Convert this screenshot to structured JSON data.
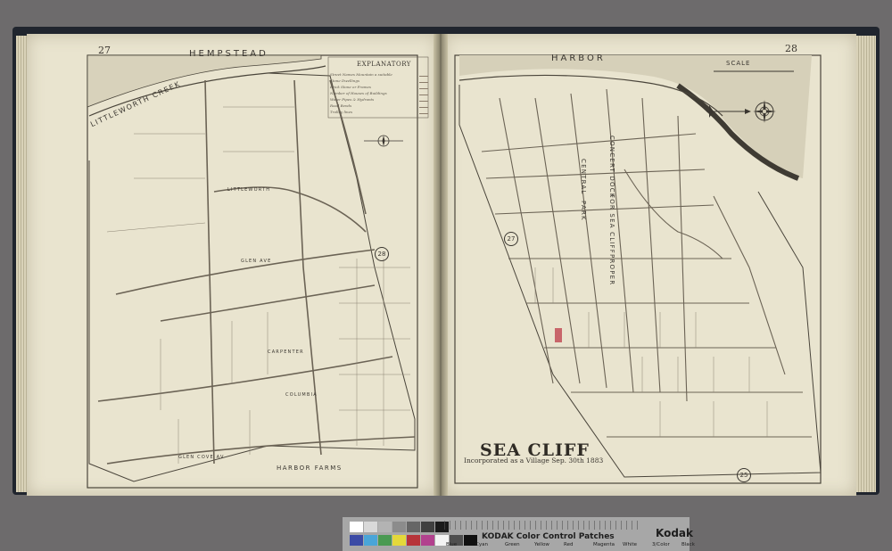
{
  "left_page": {
    "page_number": "27",
    "water_label": "HEMPSTEAD",
    "creek_label": "LITTLEWORTH CREEK",
    "legend": {
      "title": "EXPLANATORY",
      "items": [
        "Street Names Mountain a suitable",
        "Stone Dwellings",
        "Brick Stone or Frames",
        "Number of Houses of Buildings",
        "Water Pipes & Hydrants",
        "Road Bends",
        "Trolley lines"
      ]
    },
    "circled_number": "28",
    "bottom_label": "HARBOR FARMS",
    "street_labels": [
      "LITTLEWORTH",
      "GLEN AVE",
      "CARPENTER",
      "COLUMBIA",
      "GLEN COVE AV"
    ]
  },
  "right_page": {
    "page_number": "28",
    "water_label": "HARBOR",
    "scale_label": "SCALE",
    "title": "SEA CLIFF",
    "subtitle": "Incorporated as a Village Sep. 30th 1883",
    "vertical_labels": [
      "CONCERT DOCK",
      "FOR SEA CLIFF",
      "PROPER",
      "CENTRAL",
      "PARK"
    ],
    "circled_number_top": "27",
    "circled_number_bottom": "25"
  },
  "color_card": {
    "title": "KODAK Color Control Patches",
    "brand": "Kodak",
    "color_names": [
      "Blue",
      "Cyan",
      "Green",
      "Yellow",
      "Red",
      "Magenta",
      "White",
      "3/Color",
      "Black"
    ],
    "top_swatches": [
      "#ffffff",
      "#d9d9d9",
      "#b3b3b3",
      "#8c8c8c",
      "#666666",
      "#404040",
      "#1a1a1a"
    ],
    "bottom_swatches": [
      "#3b4ba5",
      "#4aa5d8",
      "#4a9a52",
      "#e4d83a",
      "#b7343a",
      "#b2418e",
      "#f3f3f3",
      "#4f4f4f",
      "#111111"
    ]
  }
}
